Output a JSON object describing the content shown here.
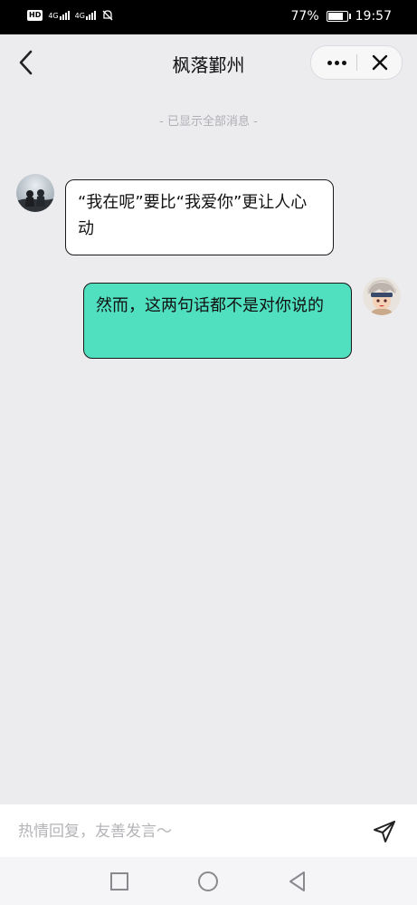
{
  "status_bar": {
    "hd_label": "HD",
    "sim1_label": "4G",
    "sim2_label": "4G",
    "battery_percent": "77%",
    "battery_level": 0.77,
    "time": "19:57",
    "icons": [
      "signal-icon",
      "mute-icon",
      "battery-icon"
    ]
  },
  "header": {
    "title": "枫落鄞州",
    "back_icon": "chevron-left-icon",
    "more_icon": "more-dots-icon",
    "close_icon": "close-icon"
  },
  "chat": {
    "notice": "- 已显示全部消息 -",
    "messages": [
      {
        "side": "left",
        "text": "“我在呢”要比“我爱你”更让人心动",
        "bubble_color": "#ffffff"
      },
      {
        "side": "right",
        "text": "然而，这两句话都不是对你说的",
        "bubble_color": "#50e0c0"
      }
    ]
  },
  "input": {
    "placeholder": "热情回复，友善发言～",
    "value": "",
    "send_icon": "send-icon"
  },
  "nav_bar": {
    "icons": [
      "recents-square-icon",
      "home-circle-icon",
      "back-triangle-icon"
    ]
  }
}
